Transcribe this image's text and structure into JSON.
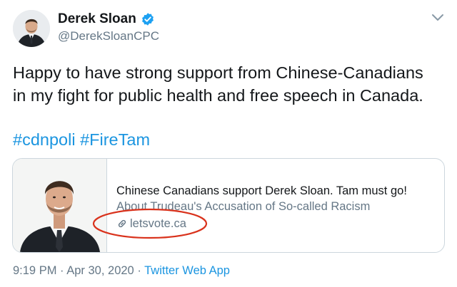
{
  "author": {
    "name": "Derek Sloan",
    "handle": "@DerekSloanCPC",
    "avatar_icon": "profile-photo",
    "verified_icon": "verified-badge-icon"
  },
  "tweet": {
    "text_lines": [
      "Happy to have strong support from Chinese-Canadians",
      "in my fight for public health and free speech in Canada."
    ],
    "hashtags": [
      "#cdnpoli",
      "#FireTam"
    ]
  },
  "card": {
    "title": "Chinese Canadians support Derek Sloan. Tam must go!",
    "description": "About Trudeau's Accusation of So-called Racism",
    "domain": "letsvote.ca",
    "link_icon": "link-icon"
  },
  "meta": {
    "time": "9:19 PM",
    "separator": "·",
    "date": "Apr 30, 2020",
    "source": "Twitter Web App"
  },
  "colors": {
    "link_blue": "#1b95e0",
    "secondary_gray": "#657786",
    "verified_blue": "#1da1f2",
    "annotation_red": "#d9321c",
    "border": "#ccd6dd"
  }
}
